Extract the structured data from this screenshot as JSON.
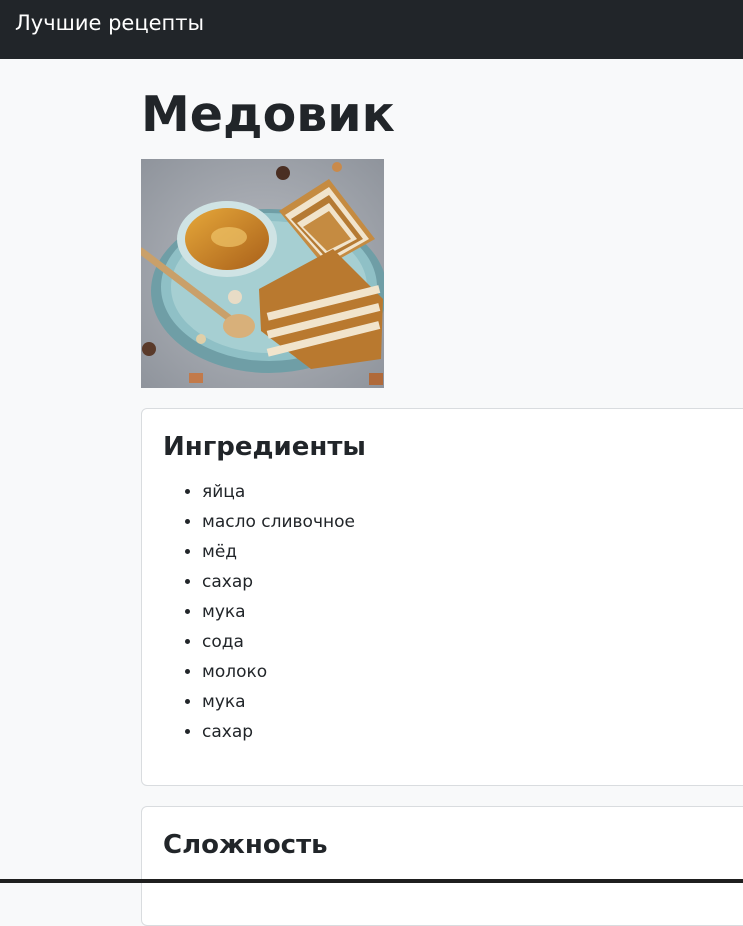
{
  "navbar": {
    "brand": "Лучшие рецепты"
  },
  "recipe": {
    "title": "Медовик",
    "image_alt": "Медовик",
    "ingredients_heading": "Ингредиенты",
    "ingredients": [
      "яйца",
      "масло сливочное",
      "мёд",
      "сахар",
      "мука",
      "сода",
      "молоко",
      "мука",
      "сахар"
    ],
    "difficulty_heading": "Сложность"
  },
  "colors": {
    "navbar": "#212529",
    "page": "#f8f9fa",
    "card": "#ffffff",
    "text": "#212529"
  }
}
